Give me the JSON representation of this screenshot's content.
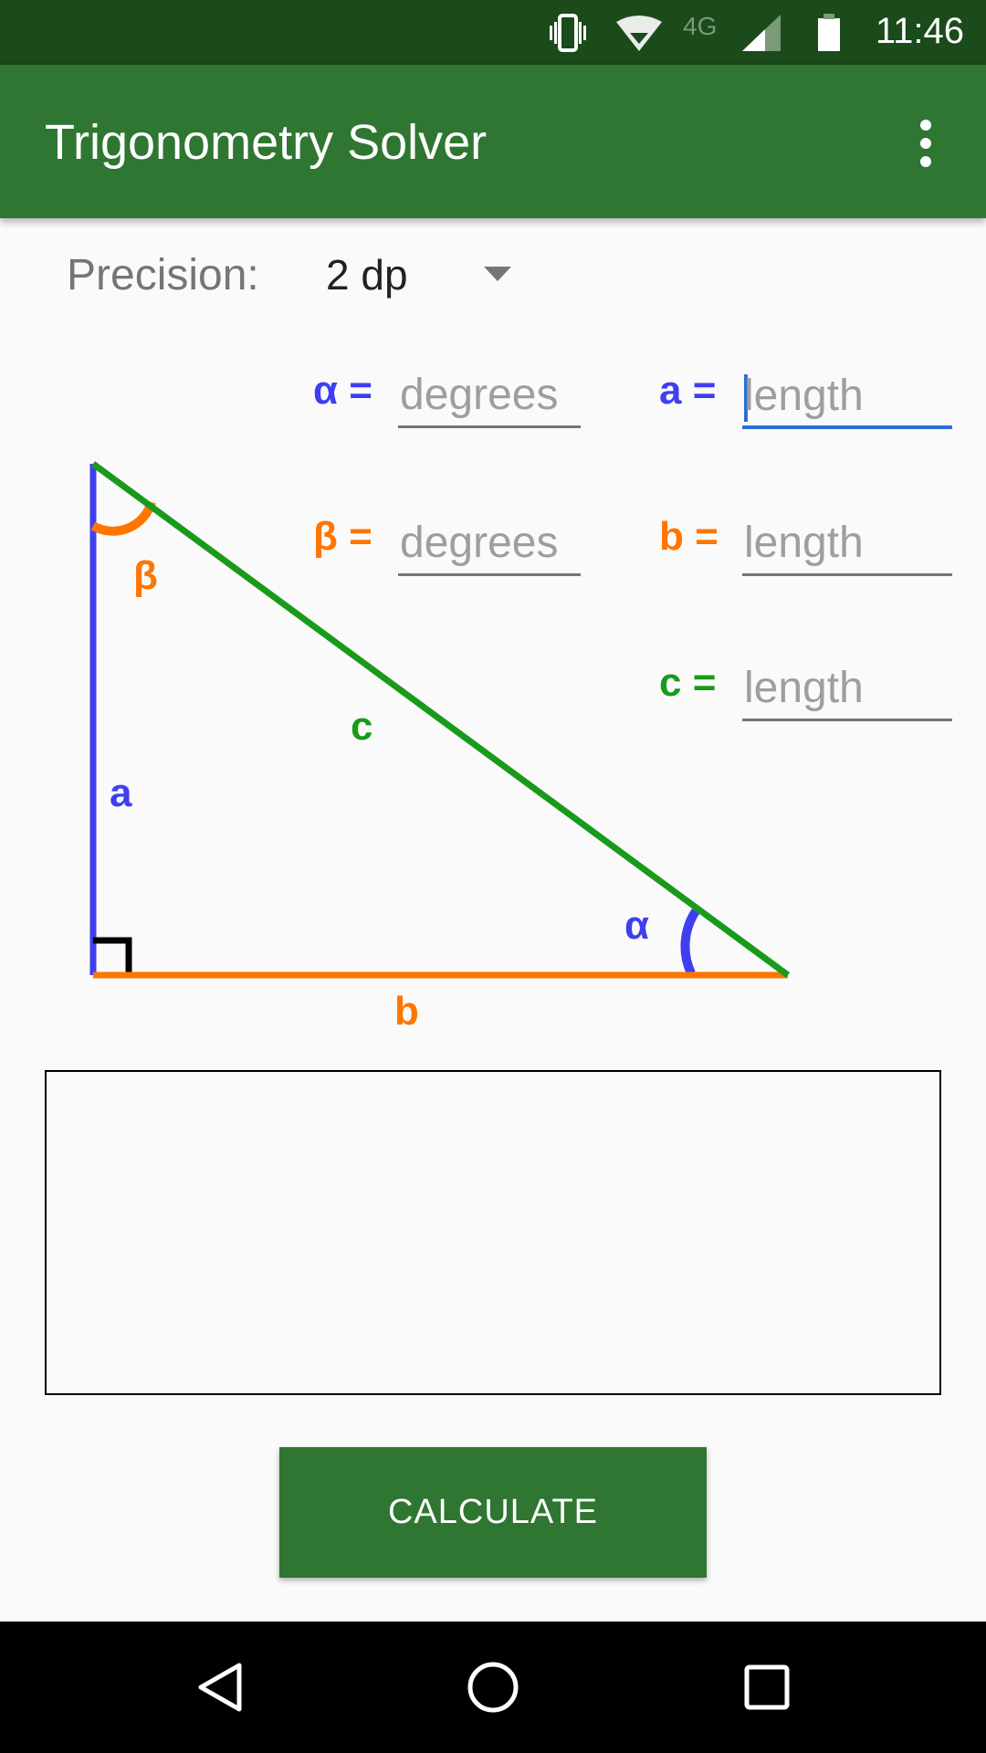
{
  "status_bar": {
    "time": "11:46",
    "network": "4G",
    "icons": [
      "vibrate-icon",
      "wifi-icon",
      "signal-icon",
      "battery-icon"
    ]
  },
  "app_bar": {
    "title": "Trigonometry Solver",
    "menu_icon": "more-vert-icon"
  },
  "precision": {
    "label": "Precision:",
    "value": "2 dp"
  },
  "inputs": {
    "alpha": {
      "label": "α =",
      "placeholder": "degrees",
      "value": ""
    },
    "beta": {
      "label": "β =",
      "placeholder": "degrees",
      "value": ""
    },
    "a": {
      "label": "a =",
      "placeholder": "length",
      "value": ""
    },
    "b": {
      "label": "b =",
      "placeholder": "length",
      "value": ""
    },
    "c": {
      "label": "c =",
      "placeholder": "length",
      "value": ""
    }
  },
  "diagram": {
    "labels": {
      "a": "a",
      "b": "b",
      "c": "c",
      "alpha": "α",
      "beta": "β"
    },
    "colors": {
      "a": "#3f3ff0",
      "b": "#ff7500",
      "c": "#1a9a1a",
      "alpha": "#3f3ff0",
      "beta": "#ff7500"
    }
  },
  "result": {
    "text": ""
  },
  "calculate_button": {
    "label": "CALCULATE"
  },
  "colors": {
    "primary": "#2e7631",
    "primary_dark": "#1b4a1b",
    "focus": "#2a6fd6"
  },
  "nav_bar": {
    "icons": [
      "back-icon",
      "home-icon",
      "recents-icon"
    ]
  }
}
